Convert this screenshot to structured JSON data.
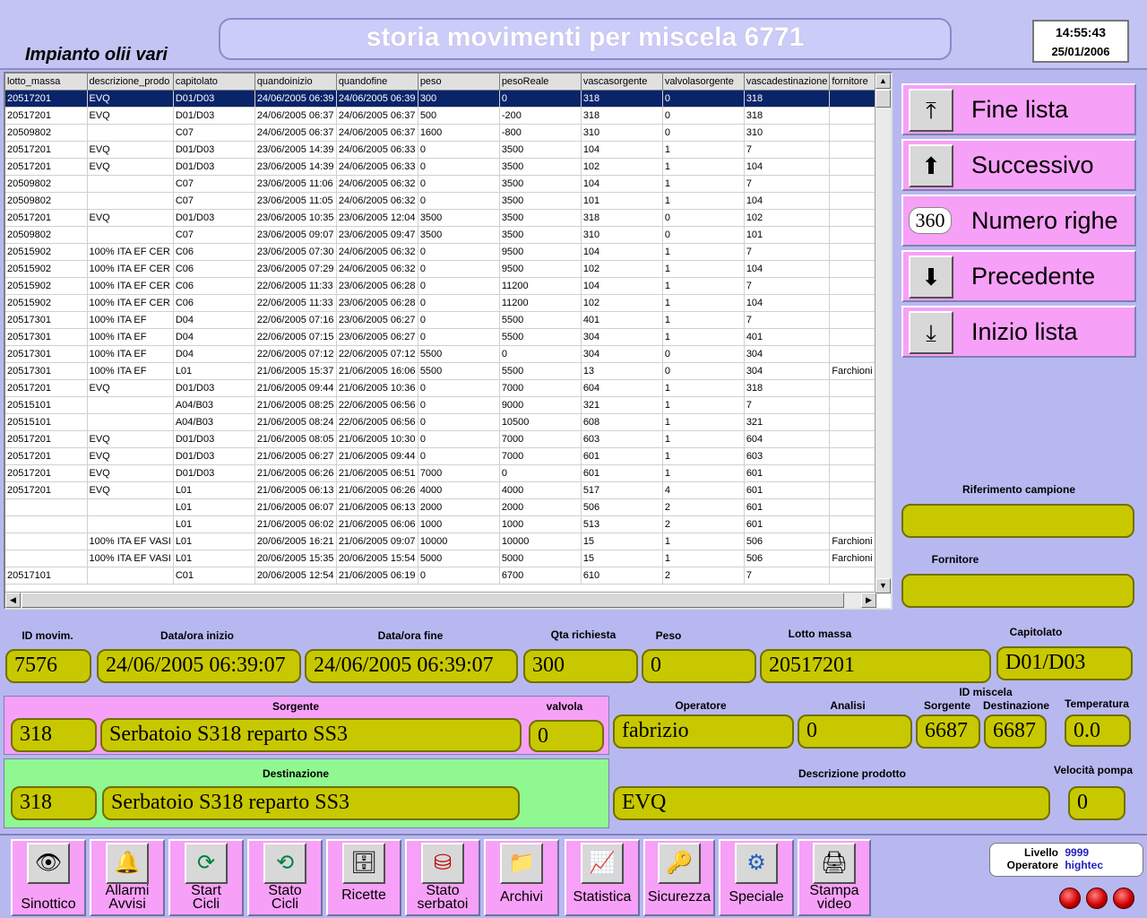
{
  "header": {
    "plant_name": "Impianto olii vari",
    "title": "storia movimenti per miscela 6771",
    "time": "14:55:43",
    "date": "25/01/2006"
  },
  "grid": {
    "columns": [
      "lotto_massa",
      "descrizione_prodo",
      "capitolato",
      "quandoinizio",
      "quandofine",
      "peso",
      "pesoReale",
      "vascasorgente",
      "valvolasorgente",
      "vascadestinazione",
      "fornitore"
    ],
    "rows": [
      [
        "20517201",
        "EVQ",
        "D01/D03",
        "24/06/2005 06:39",
        "24/06/2005 06:39",
        "300",
        "0",
        "318",
        "0",
        "318",
        ""
      ],
      [
        "20517201",
        "EVQ",
        "D01/D03",
        "24/06/2005 06:37",
        "24/06/2005 06:37",
        "500",
        "-200",
        "318",
        "0",
        "318",
        ""
      ],
      [
        "20509802",
        "",
        "C07",
        "24/06/2005 06:37",
        "24/06/2005 06:37",
        "1600",
        "-800",
        "310",
        "0",
        "310",
        ""
      ],
      [
        "20517201",
        "EVQ",
        "D01/D03",
        "23/06/2005 14:39",
        "24/06/2005 06:33",
        "0",
        "3500",
        "104",
        "1",
        "7",
        ""
      ],
      [
        "20517201",
        "EVQ",
        "D01/D03",
        "23/06/2005 14:39",
        "24/06/2005 06:33",
        "0",
        "3500",
        "102",
        "1",
        "104",
        ""
      ],
      [
        "20509802",
        "",
        "C07",
        "23/06/2005 11:06",
        "24/06/2005 06:32",
        "0",
        "3500",
        "104",
        "1",
        "7",
        ""
      ],
      [
        "20509802",
        "",
        "C07",
        "23/06/2005 11:05",
        "24/06/2005 06:32",
        "0",
        "3500",
        "101",
        "1",
        "104",
        ""
      ],
      [
        "20517201",
        "EVQ",
        "D01/D03",
        "23/06/2005 10:35",
        "23/06/2005 12:04",
        "3500",
        "3500",
        "318",
        "0",
        "102",
        ""
      ],
      [
        "20509802",
        "",
        "C07",
        "23/06/2005 09:07",
        "23/06/2005 09:47",
        "3500",
        "3500",
        "310",
        "0",
        "101",
        ""
      ],
      [
        "20515902",
        "100% ITA EF CER",
        "C06",
        "23/06/2005 07:30",
        "24/06/2005 06:32",
        "0",
        "9500",
        "104",
        "1",
        "7",
        ""
      ],
      [
        "20515902",
        "100% ITA EF CER",
        "C06",
        "23/06/2005 07:29",
        "24/06/2005 06:32",
        "0",
        "9500",
        "102",
        "1",
        "104",
        ""
      ],
      [
        "20515902",
        "100% ITA EF CER",
        "C06",
        "22/06/2005 11:33",
        "23/06/2005 06:28",
        "0",
        "11200",
        "104",
        "1",
        "7",
        ""
      ],
      [
        "20515902",
        "100% ITA EF CER",
        "C06",
        "22/06/2005 11:33",
        "23/06/2005 06:28",
        "0",
        "11200",
        "102",
        "1",
        "104",
        ""
      ],
      [
        "20517301",
        "100% ITA EF",
        "D04",
        "22/06/2005 07:16",
        "23/06/2005 06:27",
        "0",
        "5500",
        "401",
        "1",
        "7",
        ""
      ],
      [
        "20517301",
        "100% ITA EF",
        "D04",
        "22/06/2005 07:15",
        "23/06/2005 06:27",
        "0",
        "5500",
        "304",
        "1",
        "401",
        ""
      ],
      [
        "20517301",
        "100% ITA EF",
        "D04",
        "22/06/2005 07:12",
        "22/06/2005 07:12",
        "5500",
        "0",
        "304",
        "0",
        "304",
        ""
      ],
      [
        "20517301",
        "100% ITA EF",
        "L01",
        "21/06/2005 15:37",
        "21/06/2005 16:06",
        "5500",
        "5500",
        "13",
        "0",
        "304",
        "Farchioni vi"
      ],
      [
        "20517201",
        "EVQ",
        "D01/D03",
        "21/06/2005 09:44",
        "21/06/2005 10:36",
        "0",
        "7000",
        "604",
        "1",
        "318",
        ""
      ],
      [
        "20515101",
        "",
        "A04/B03",
        "21/06/2005 08:25",
        "22/06/2005 06:56",
        "0",
        "9000",
        "321",
        "1",
        "7",
        ""
      ],
      [
        "20515101",
        "",
        "A04/B03",
        "21/06/2005 08:24",
        "22/06/2005 06:56",
        "0",
        "10500",
        "608",
        "1",
        "321",
        ""
      ],
      [
        "20517201",
        "EVQ",
        "D01/D03",
        "21/06/2005 08:05",
        "21/06/2005 10:30",
        "0",
        "7000",
        "603",
        "1",
        "604",
        ""
      ],
      [
        "20517201",
        "EVQ",
        "D01/D03",
        "21/06/2005 06:27",
        "21/06/2005 09:44",
        "0",
        "7000",
        "601",
        "1",
        "603",
        ""
      ],
      [
        "20517201",
        "EVQ",
        "D01/D03",
        "21/06/2005 06:26",
        "21/06/2005 06:51",
        "7000",
        "0",
        "601",
        "1",
        "601",
        ""
      ],
      [
        "20517201",
        "EVQ",
        "L01",
        "21/06/2005 06:13",
        "21/06/2005 06:26",
        "4000",
        "4000",
        "517",
        "4",
        "601",
        ""
      ],
      [
        "",
        "",
        "L01",
        "21/06/2005 06:07",
        "21/06/2005 06:13",
        "2000",
        "2000",
        "506",
        "2",
        "601",
        ""
      ],
      [
        "",
        "",
        "L01",
        "21/06/2005 06:02",
        "21/06/2005 06:06",
        "1000",
        "1000",
        "513",
        "2",
        "601",
        ""
      ],
      [
        "",
        "100% ITA EF VASI",
        "L01",
        "20/06/2005 16:21",
        "21/06/2005 09:07",
        "10000",
        "10000",
        "15",
        "1",
        "506",
        "Farchioni vi"
      ],
      [
        "",
        "100% ITA EF VASI",
        "L01",
        "20/06/2005 15:35",
        "20/06/2005 15:54",
        "5000",
        "5000",
        "15",
        "1",
        "506",
        "Farchioni vi"
      ],
      [
        "20517101",
        "",
        "C01",
        "20/06/2005 12:54",
        "21/06/2005 06:19",
        "0",
        "6700",
        "610",
        "2",
        "7",
        ""
      ]
    ]
  },
  "nav": {
    "fine_lista": "Fine lista",
    "successivo": "Successivo",
    "numero_righe": "Numero righe",
    "numero_righe_value": "360",
    "precedente": "Precedente",
    "inizio_lista": "Inizio lista"
  },
  "side": {
    "riferimento_label": "Riferimento campione",
    "riferimento_value": "",
    "fornitore_label": "Fornitore",
    "fornitore_value": ""
  },
  "detail": {
    "id_movim_label": "ID movim.",
    "id_movim": "7576",
    "data_inizio_label": "Data/ora inizio",
    "data_inizio": "24/06/2005 06:39:07",
    "data_fine_label": "Data/ora fine",
    "data_fine": "24/06/2005 06:39:07",
    "qta_label": "Qta richiesta",
    "qta": "300",
    "peso_label": "Peso",
    "peso": "0",
    "lotto_label": "Lotto massa",
    "lotto": "20517201",
    "capitolato_label": "Capitolato",
    "capitolato": "D01/D03",
    "sorgente_label": "Sorgente",
    "sorgente_num": "318",
    "sorgente_desc": "Serbatoio S318 reparto SS3",
    "valvola_label": "valvola",
    "valvola": "0",
    "destinazione_label": "Destinazione",
    "destinazione_num": "318",
    "destinazione_desc": "Serbatoio S318 reparto SS3",
    "operatore_label": "Operatore",
    "operatore": "fabrizio",
    "analisi_label": "Analisi",
    "analisi": "0",
    "id_miscela_label": "ID miscela",
    "id_sorgente_label": "Sorgente",
    "id_sorgente": "6687",
    "id_destinazione_label": "Destinazione",
    "id_destinazione": "6687",
    "temperatura_label": "Temperatura",
    "temperatura": "0.0",
    "descrizione_label": "Descrizione prodotto",
    "descrizione": "EVQ",
    "velocita_label": "Velocità pompa",
    "velocita": "0"
  },
  "toolbar": {
    "sinottico": "Sinottico",
    "allarmi": [
      "Allarmi",
      "Avvisi"
    ],
    "start": [
      "Start",
      "Cicli"
    ],
    "stato_cicli": [
      "Stato",
      "Cicli"
    ],
    "ricette": "Ricette",
    "stato_serbatoi": [
      "Stato",
      "serbatoi"
    ],
    "archivi": "Archivi",
    "statistica": "Statistica",
    "sicurezza": "Sicurezza",
    "speciale": "Speciale",
    "stampa": [
      "Stampa",
      "video"
    ]
  },
  "status": {
    "livello_label": "Livello",
    "livello": "9999",
    "operatore_label": "Operatore",
    "operatore": "hightec"
  },
  "icons": {
    "fine_lista": "double-up-bar-icon",
    "successivo": "up-arrow-icon",
    "precedente": "down-arrow-icon",
    "inizio_lista": "double-down-bar-icon",
    "sinottico": "eye-icon",
    "allarmi": "bell-icon",
    "start": "cycle-icon",
    "stato_cicli": "binoculars-cycle-icon",
    "ricette": "cabinet-icon",
    "stato_serbatoi": "tank-icon",
    "archivi": "folder-icon",
    "statistica": "chart-icon",
    "sicurezza": "keys-icon",
    "speciale": "gears-icon",
    "stampa": "printer-icon"
  }
}
